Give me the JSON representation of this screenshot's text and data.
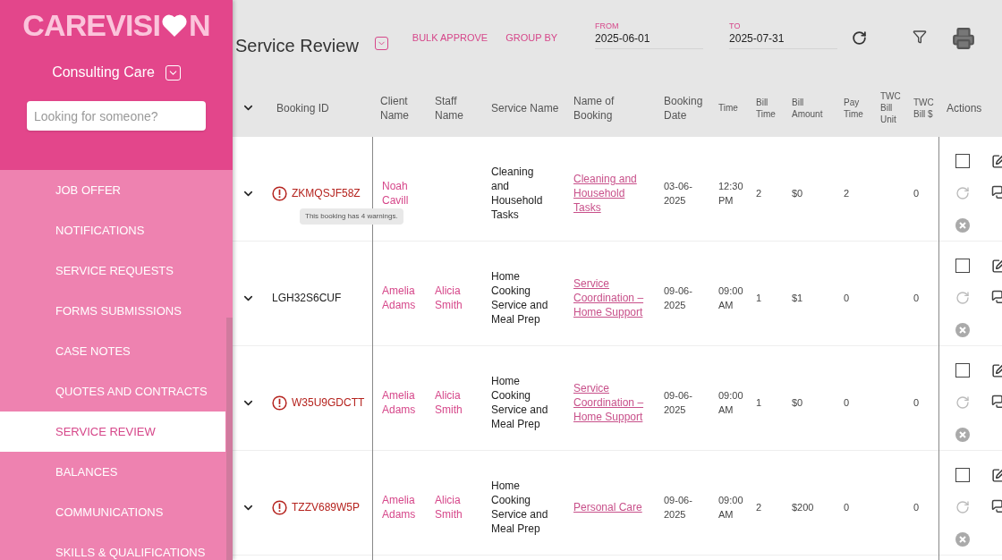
{
  "sidebar": {
    "logo": {
      "text_before": "CAREVISI",
      "text_after": "N"
    },
    "organization": "Consulting Care",
    "search": {
      "placeholder": "Looking for someone?"
    },
    "items": [
      {
        "label": "JOB OFFER",
        "selected": false
      },
      {
        "label": "NOTIFICATIONS",
        "selected": false
      },
      {
        "label": "SERVICE REQUESTS",
        "selected": false
      },
      {
        "label": "FORMS SUBMISSIONS",
        "selected": false
      },
      {
        "label": "CASE NOTES",
        "selected": false
      },
      {
        "label": "QUOTES AND CONTRACTS",
        "selected": false
      },
      {
        "label": "SERVICE REVIEW",
        "selected": true
      },
      {
        "label": "BALANCES",
        "selected": false
      },
      {
        "label": "COMMUNICATIONS",
        "selected": false
      },
      {
        "label": "SKILLS & QUALIFICATIONS",
        "selected": false
      }
    ]
  },
  "toolbar": {
    "title": "Service Review",
    "actions": [
      "BULK APPROVE",
      "GROUP BY"
    ],
    "from": {
      "label": "FROM",
      "value": "2025-06-01"
    },
    "to": {
      "label": "TO",
      "value": "2025-07-31"
    }
  },
  "table": {
    "columns": [
      "Booking ID",
      "Client Name",
      "Staff Name",
      "Service Name",
      "Name of Booking",
      "Booking Date",
      "Time",
      "Bill Time",
      "Bill Amount",
      "Pay Time",
      "TWC Bill Unit",
      "TWC Bill $",
      "Actions"
    ],
    "rows": [
      {
        "warning": true,
        "booking_id": "ZKMQSJF58Z",
        "tooltip": "This booking has 4 warnings.",
        "client": "Noah Cavill",
        "service": "Cleaning and Household Tasks",
        "booking_name": "Cleaning and Household Tasks",
        "date": "03-06-2025",
        "time": "12:30 PM",
        "bill_time": "2",
        "bill_amount": "$0",
        "pay_time": "2",
        "twc_bill": "0",
        "checked": false
      },
      {
        "warning": false,
        "booking_id": "LGH32S6CUF",
        "client": "Amelia Adams",
        "staff": "Alicia Smith",
        "service": "Home Cooking Service and Meal Prep",
        "booking_name": "Service Coordination – Home Support",
        "date": "09-06-2025",
        "time": "09:00 AM",
        "bill_time": "1",
        "bill_amount": "$1",
        "pay_time": "0",
        "twc_bill": "0",
        "checked": false
      },
      {
        "warning": true,
        "booking_id": "W35U9GDCTT",
        "client": "Amelia Adams",
        "staff": "Alicia Smith",
        "service": "Home Cooking Service and Meal Prep",
        "booking_name": "Service Coordination – Home Support",
        "date": "09-06-2025",
        "time": "09:00 AM",
        "bill_time": "1",
        "bill_amount": "$0",
        "pay_time": "0",
        "twc_bill": "0",
        "checked": false
      },
      {
        "warning": true,
        "booking_id": "TZZV689W5P",
        "client": "Amelia Adams",
        "staff": "Alicia Smith",
        "service": "Home Cooking Service and Meal Prep",
        "booking_name": "Personal Care",
        "date": "09-06-2025",
        "time": "09:00 AM",
        "bill_time": "2",
        "bill_amount": "$200",
        "pay_time": "0",
        "twc_bill": "0",
        "checked": false
      }
    ]
  }
}
